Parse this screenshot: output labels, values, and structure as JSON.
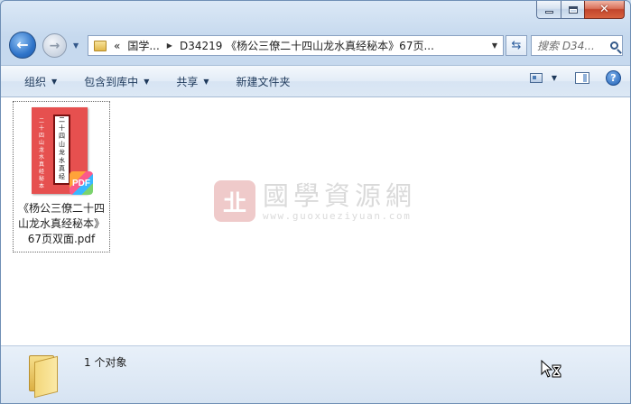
{
  "window": {
    "controls": {
      "minimize": "minimize",
      "maximize": "maximize",
      "close": "close"
    }
  },
  "nav": {
    "breadcrumb": {
      "overflow": "«",
      "items": [
        "国学...",
        "D34219 《杨公三僚二十四山龙水真经秘本》67页..."
      ]
    },
    "search_placeholder": "搜索 D34..."
  },
  "toolbar": {
    "organize": "组织",
    "include_in_library": "包含到库中",
    "share": "共享",
    "new_folder": "新建文件夹"
  },
  "file": {
    "name": "《杨公三僚二十四山龙水真经秘本》67页双面.pdf",
    "name_lines": [
      "《杨公三僚二十四",
      "山龙水真经秘本》",
      "67页双面.pdf"
    ],
    "badge": "PDF",
    "cover_title": [
      "二",
      "十",
      "四",
      "山",
      "龙",
      "水",
      "真",
      "经",
      "秘",
      "本"
    ],
    "cover_side": [
      "二",
      "十",
      "四",
      "山",
      "龙",
      "水",
      "真",
      "经",
      "秘",
      "本"
    ]
  },
  "watermark": {
    "title": "國學資源網",
    "url": "www.guoxueziyuan.com",
    "logo_char": "㐀"
  },
  "status": {
    "count_text": "1 个对象"
  },
  "colors": {
    "accent": "#1e395b",
    "close_button": "#c2452c",
    "cover_red": "#e6504f"
  }
}
